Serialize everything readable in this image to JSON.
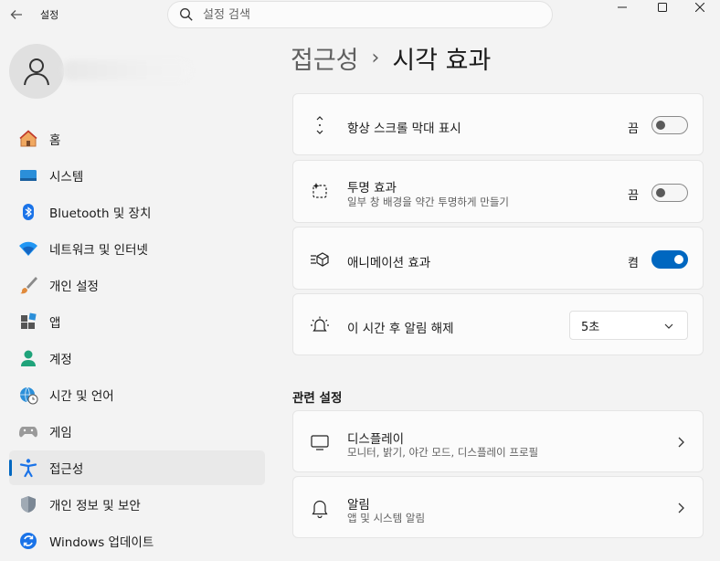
{
  "window": {
    "app_title": "설정"
  },
  "search": {
    "placeholder": "설정 검색"
  },
  "sidebar": {
    "items": [
      {
        "label": "홈",
        "icon": "home-icon"
      },
      {
        "label": "시스템",
        "icon": "system-icon"
      },
      {
        "label": "Bluetooth 및 장치",
        "icon": "bluetooth-icon"
      },
      {
        "label": "네트워크 및 인터넷",
        "icon": "wifi-icon"
      },
      {
        "label": "개인 설정",
        "icon": "brush-icon"
      },
      {
        "label": "앱",
        "icon": "apps-icon"
      },
      {
        "label": "계정",
        "icon": "account-icon"
      },
      {
        "label": "시간 및 언어",
        "icon": "globe-clock-icon"
      },
      {
        "label": "게임",
        "icon": "gamepad-icon"
      },
      {
        "label": "접근성",
        "icon": "accessibility-icon",
        "selected": true
      },
      {
        "label": "개인 정보 및 보안",
        "icon": "shield-icon"
      },
      {
        "label": "Windows 업데이트",
        "icon": "update-icon"
      }
    ]
  },
  "breadcrumb": {
    "parent": "접근성",
    "separator": "›",
    "current": "시각 효과"
  },
  "settings": {
    "scrollbars": {
      "title": "항상 스크롤 막대 표시",
      "state_text": "끔",
      "on": false
    },
    "transparency": {
      "title": "투명 효과",
      "description": "일부 창 배경을 약간 투명하게 만들기",
      "state_text": "끔",
      "on": false
    },
    "animation": {
      "title": "애니메이션 효과",
      "state_text": "켬",
      "on": true
    },
    "dismiss": {
      "title": "이 시간 후 알림 해제",
      "selected": "5초"
    }
  },
  "related": {
    "section_title": "관련 설정",
    "display": {
      "title": "디스플레이",
      "description": "모니터, 밝기, 야간 모드, 디스플레이 프로필"
    },
    "notifications": {
      "title": "알림",
      "description": "앱 및 시스템 알림"
    }
  },
  "colors": {
    "accent": "#0067c0",
    "background": "#f3f3f3",
    "card": "#fbfbfb"
  }
}
